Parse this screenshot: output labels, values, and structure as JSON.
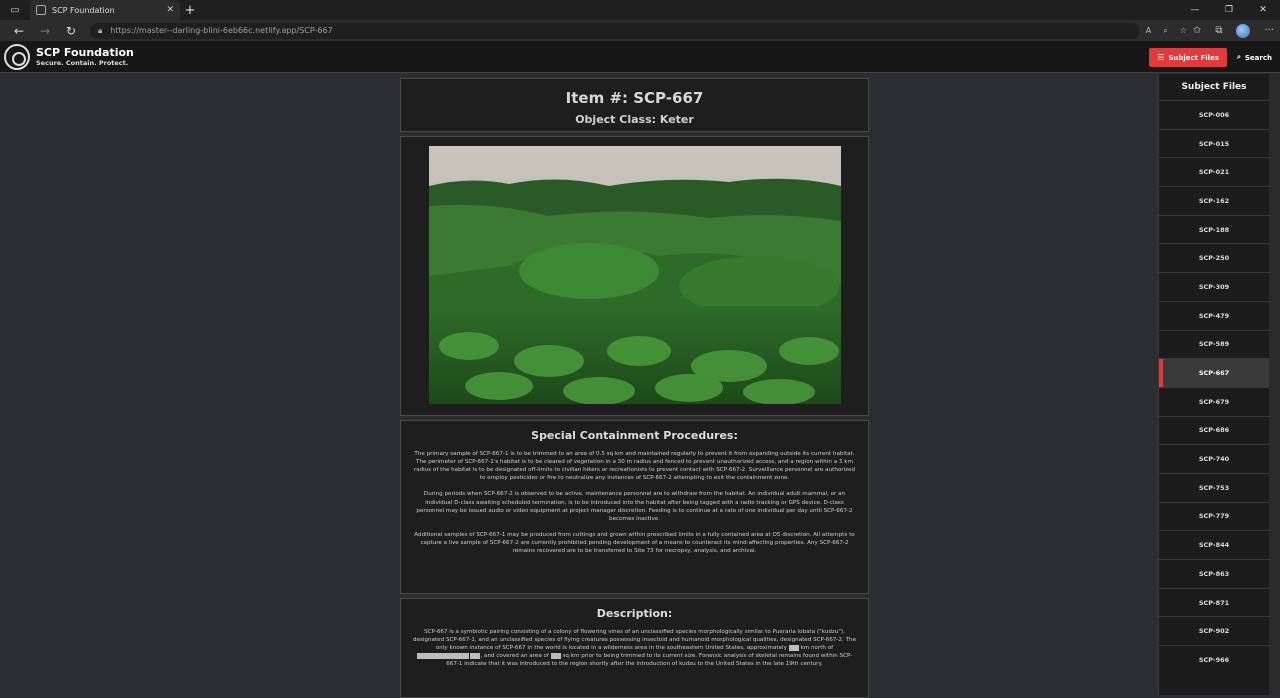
{
  "browser": {
    "tab_title": "SCP Foundation",
    "url_host": "https://master--darling-blini-6eb66c.netlify.app",
    "url_path": "/SCP-667"
  },
  "header": {
    "brand_name": "SCP Foundation",
    "brand_motto": "Secure. Contain. Protect.",
    "subject_files_label": "Subject Files",
    "search_label": "Search"
  },
  "item": {
    "title": "Item #: SCP-667",
    "object_class": "Object Class: Keter"
  },
  "procedures": {
    "heading": "Special Containment Procedures:",
    "p1": "The primary sample of SCP-667-1 is to be trimmed to an area of 0.5 sq km and maintained regularly to prevent it from expanding outside its current habitat. The perimeter of SCP-667-1's habitat is to be cleared of vegetation in a 30 m radius and fenced to prevent unauthorized access, and a region within a 3 km radius of the habitat is to be designated off-limits to civilian hikers or recreationists to prevent contact with SCP-667-2. Surveillance personnel are authorized to employ pesticides or fire to neutralize any instances of SCP-667-2 attempting to exit the containment zone.",
    "p2": "During periods when SCP-667-2 is observed to be active, maintenance personnel are to withdraw from the habitat. An individual adult mammal, or an individual D-class awaiting scheduled termination, is to be introduced into the habitat after being tagged with a radio tracking or GPS device. D-class personnel may be issued audio or video equipment at project manager discretion. Feeding is to continue at a rate of one individual per day until SCP-667-2 becomes inactive.",
    "p3": "Additional samples of SCP-667-1 may be produced from cuttings and grown within prescribed limits in a fully contained area at O5 discretion. All attempts to capture a live sample of SCP-667-2 are currently prohibited pending development of a means to counteract its mind-affecting properties. Any SCP-667-2 remains recovered are to be transferred to Site 73 for necropsy, analysis, and archival."
  },
  "description": {
    "heading": "Description:",
    "p1_a": "SCP-667 is a symbiotic pairing consisting of a colony of flowering vines of an unclassified species morphologically similar to Pueraria lobata (\"kudzu\"), designated SCP-667-1, and an unclassified species of flying creatures possessing insectoid and humanoid morphological qualities, designated SCP-667-2. The only known instance of SCP-667 in the world is located in a wilderness area in the southeastern United States, approximately",
    "p1_b": "km north of",
    "p1_c": ", and covered an area of",
    "p1_d": "sq km prior to being trimmed to its current size. Forensic analysis of skeletal remains found within SCP-667-1 indicate that it was introduced to the region shortly after the introduction of kudzu to the United States in the late 19th century."
  },
  "sidebar": {
    "title": "Subject Files",
    "items": [
      "SCP-006",
      "SCP-015",
      "SCP-021",
      "SCP-162",
      "SCP-188",
      "SCP-250",
      "SCP-309",
      "SCP-479",
      "SCP-589",
      "SCP-667",
      "SCP-679",
      "SCP-686",
      "SCP-740",
      "SCP-753",
      "SCP-779",
      "SCP-844",
      "SCP-863",
      "SCP-871",
      "SCP-902",
      "SCP-966"
    ],
    "active": "SCP-667"
  },
  "colors": {
    "accent": "#e03a3e",
    "background": "#2b2d30"
  }
}
